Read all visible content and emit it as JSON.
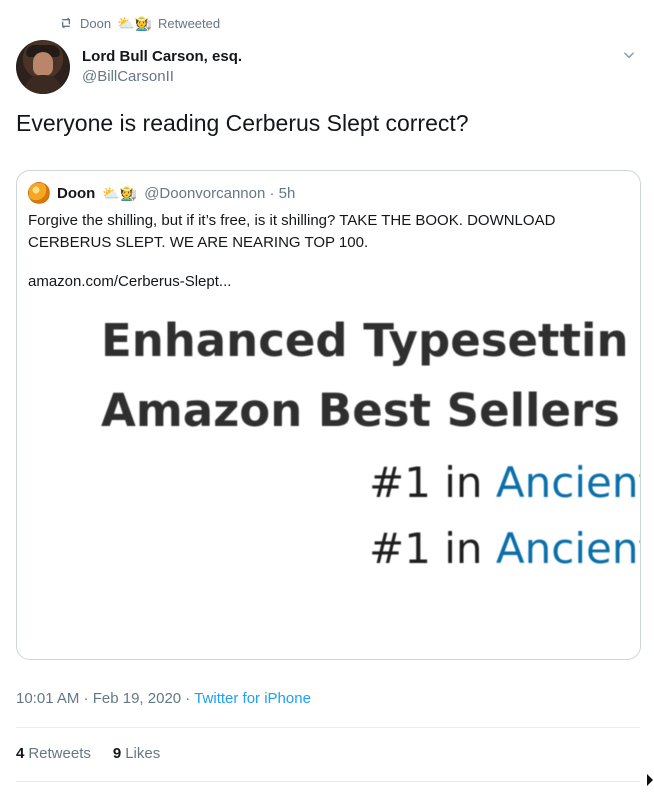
{
  "retweet": {
    "user": "Doon",
    "emoji": "⛅🧑‍🌾",
    "label": "Retweeted",
    "icon": "retweet-icon"
  },
  "author": {
    "display_name": "Lord Bull Carson, esq.",
    "handle": "@BillCarsonII",
    "avatar": "avatar",
    "menu_icon": "chevron-down-icon"
  },
  "tweet": {
    "text": "Everyone is reading Cerberus Slept correct?"
  },
  "quote": {
    "name": "Doon",
    "emoji": "⛅🧑‍🌾",
    "handle_time": "@Doonvorcannon · 5h",
    "body": "Forgive the shilling, but if it’s free, is it shilling? TAKE THE BOOK. DOWNLOAD CERBERUS SLEPT. WE ARE NEARING TOP 100.",
    "link": "amazon.com/Cerberus-Slept...",
    "image_lines": [
      {
        "type": "heading",
        "text": "Enhanced Typesettin"
      },
      {
        "type": "heading",
        "text": "Amazon Best Sellers"
      },
      {
        "type": "rank",
        "prefix": "#1 in ",
        "link": "Ancient"
      },
      {
        "type": "rank",
        "prefix": "#1 in ",
        "link": "Ancient"
      }
    ]
  },
  "meta": {
    "time": "10:01 AM",
    "date": "Feb 19, 2020",
    "separator": " · ",
    "source": "Twitter for iPhone"
  },
  "stats": {
    "retweets_count": "4",
    "retweets_label": "Retweets",
    "likes_count": "9",
    "likes_label": "Likes"
  },
  "colors": {
    "accent": "#1da1f2",
    "muted": "#657786",
    "text": "#14171a",
    "border": "#ccd6dd"
  }
}
